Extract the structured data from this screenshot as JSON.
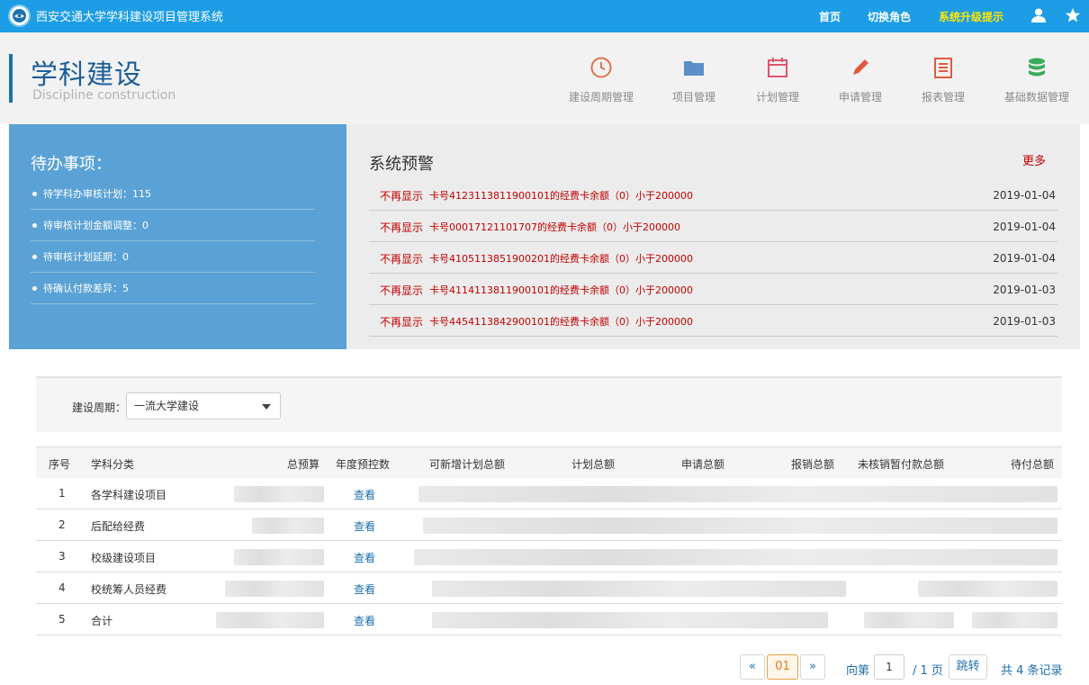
{
  "topbar": {
    "app_title": "西安交通大学学科建设项目管理系统",
    "nav": [
      "首页",
      "切换角色",
      "系统升级提示"
    ],
    "user_icon": "user-icon",
    "favorite_icon": "star-icon"
  },
  "header": {
    "title": "学科建设",
    "subtitle": "Discipline construction",
    "modules": [
      {
        "label": "建设周期管理",
        "icon": "clock-icon",
        "color": "#e0724d"
      },
      {
        "label": "项目管理",
        "icon": "folder-icon",
        "color": "#5b8fc9"
      },
      {
        "label": "计划管理",
        "icon": "calendar-icon",
        "color": "#e0546f"
      },
      {
        "label": "申请管理",
        "icon": "pen-icon",
        "color": "#e05a3f"
      },
      {
        "label": "报表管理",
        "icon": "report-icon",
        "color": "#e05a3f"
      },
      {
        "label": "基础数据管理",
        "icon": "database-icon",
        "color": "#3cab5c"
      }
    ]
  },
  "todo": {
    "title": "待办事项：",
    "items": [
      "待学科办审核计划：115",
      "待审核计划金额调整：0",
      "待审核计划延期：0",
      "待确认付款差异：5"
    ]
  },
  "warning": {
    "title": "系统预警",
    "more": "更多",
    "rows": [
      {
        "action": "不再显示",
        "message": "卡号4123113811900101的经费卡余额（0）小于200000",
        "date": "2019-01-04"
      },
      {
        "action": "不再显示",
        "message": "卡号00017121101707的经费卡余额（0）小于200000",
        "date": "2019-01-04"
      },
      {
        "action": "不再显示",
        "message": "卡号4105113851900201的经费卡余额（0）小于200000",
        "date": "2019-01-04"
      },
      {
        "action": "不再显示",
        "message": "卡号4114113811900101的经费卡余额（0）小于200000",
        "date": "2019-01-03"
      },
      {
        "action": "不再显示",
        "message": "卡号4454113842900101的经费卡余额（0）小于200000",
        "date": "2019-01-03"
      }
    ]
  },
  "filter": {
    "label": "建设周期：",
    "selected": "一流大学建设"
  },
  "table": {
    "headers": [
      "序号",
      "学科分类",
      "总预算",
      "年度预控数",
      "可新增计划总额",
      "计划总额",
      "申请总额",
      "报销总额",
      "未核销暂付款总额",
      "待付总额"
    ],
    "rows": [
      {
        "index": "1",
        "category": "各学科建设项目",
        "action": "查看"
      },
      {
        "index": "2",
        "category": "后配给经费",
        "action": "查看"
      },
      {
        "index": "3",
        "category": "校级建设项目",
        "action": "查看"
      },
      {
        "index": "4",
        "category": "校统筹人员经费",
        "action": "查看"
      },
      {
        "index": "5",
        "category": "合计",
        "action": "查看"
      }
    ]
  },
  "pager": {
    "prev": "«",
    "current": "01",
    "next": "»",
    "goto_prefix": "向第",
    "goto_value": "1",
    "total_pages": "/ 1 页",
    "jump": "跳转",
    "total_records": "共 4 条记录"
  }
}
